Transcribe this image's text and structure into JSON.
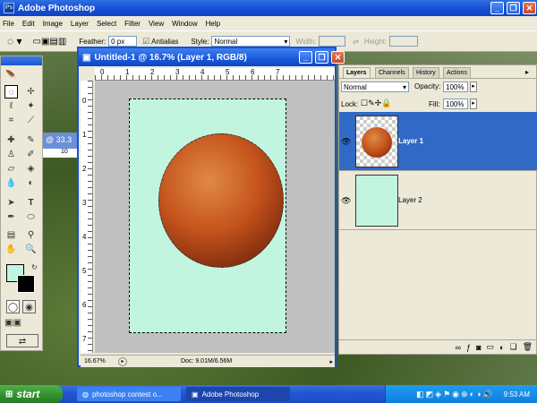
{
  "app": {
    "title": "Adobe Photoshop"
  },
  "menu": [
    "File",
    "Edit",
    "Image",
    "Layer",
    "Select",
    "Filter",
    "View",
    "Window",
    "Help"
  ],
  "options": {
    "feather_label": "Feather:",
    "feather_value": "0 px",
    "antialias_label": "Antialias",
    "style_label": "Style:",
    "style_value": "Normal",
    "width_label": "Width:",
    "height_label": "Height:"
  },
  "document": {
    "title": "Untitled-1 @ 16.7% (Layer 1, RGB/8)",
    "zoom": "16.67%",
    "doc_info": "Doc: 9.01M/6.56M",
    "ruler_top": [
      "0",
      "1",
      "2",
      "3",
      "4",
      "5",
      "6",
      "7"
    ],
    "ruler_left": [
      "0",
      "1",
      "2",
      "3",
      "4",
      "5",
      "6",
      "7"
    ]
  },
  "behind_doc": {
    "zoom_fragment": "@ 33.3",
    "ruler": "10"
  },
  "layers_panel": {
    "tabs": [
      "Layers",
      "Channels",
      "History",
      "Actions"
    ],
    "blend_mode": "Normal",
    "opacity_label": "Opacity:",
    "opacity_value": "100%",
    "lock_label": "Lock:",
    "fill_label": "Fill:",
    "fill_value": "100%",
    "layers": [
      {
        "name": "Layer 1",
        "selected": true
      },
      {
        "name": "Layer 2",
        "selected": false
      }
    ]
  },
  "taskbar": {
    "start": "start",
    "tasks": [
      {
        "label": "photoshop contest o...",
        "active": false
      },
      {
        "label": "Adobe Photoshop",
        "active": true
      }
    ],
    "clock": "9:53 AM"
  },
  "colors": {
    "canvas": "#c2f5df",
    "selection_blue": "#3169c6",
    "title_blue": "#1858d8"
  }
}
